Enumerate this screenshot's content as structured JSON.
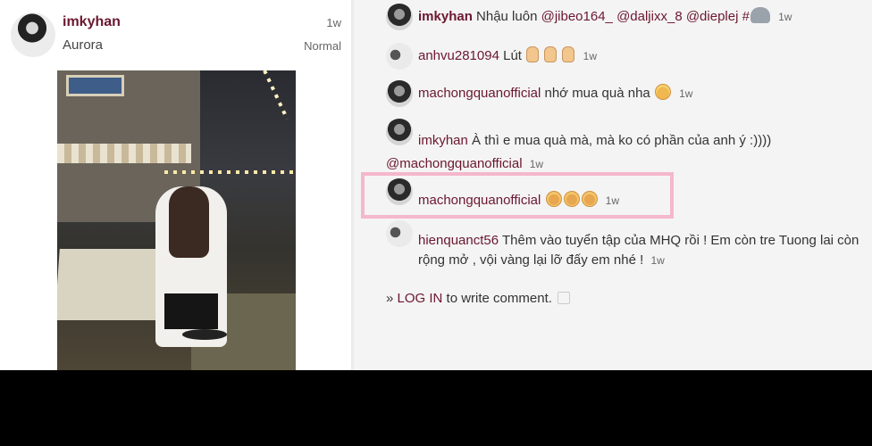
{
  "post": {
    "username": "imkyhan",
    "location": "Aurora",
    "time": "1w",
    "filter": "Normal"
  },
  "comments": [
    {
      "username": "imkyhan",
      "text": "Nhậu luôn",
      "mentions": [
        "@jibeo164_",
        "@daljixx_8",
        "@dieplej"
      ],
      "tail": "#",
      "time": "1w"
    },
    {
      "username": "anhvu281094",
      "text": "Lút",
      "time": "1w"
    },
    {
      "username": "machongquanofficial",
      "text": "nhớ mua quà nha",
      "time": "1w"
    },
    {
      "username": "imkyhan",
      "text": "À thì e mua quà mà, mà ko có phần của anh ý :))))",
      "mention": "@machongquanofficial",
      "time": "1w"
    },
    {
      "username": "machongquanofficial",
      "time": "1w"
    },
    {
      "username": "hienquanct56",
      "text": "Thêm vào tuyển tập của MHQ rồi ! Em còn tre Tuong lai còn rộng mở , vội vàng lại lỡ đấy em nhé !",
      "time": "1w"
    }
  ],
  "login": {
    "prefix": "»",
    "link": "LOG IN",
    "suffix": "to write comment."
  },
  "icons": {
    "emoji_flushed": "flushed-face-icon",
    "emoji_grin": "grinning-sweat-icon",
    "emoji_hand": "pointing-hand-icon",
    "emoji_elephant": "elephant-icon"
  },
  "colors": {
    "username": "#6b1730",
    "highlight_border": "#f4b7cc"
  }
}
